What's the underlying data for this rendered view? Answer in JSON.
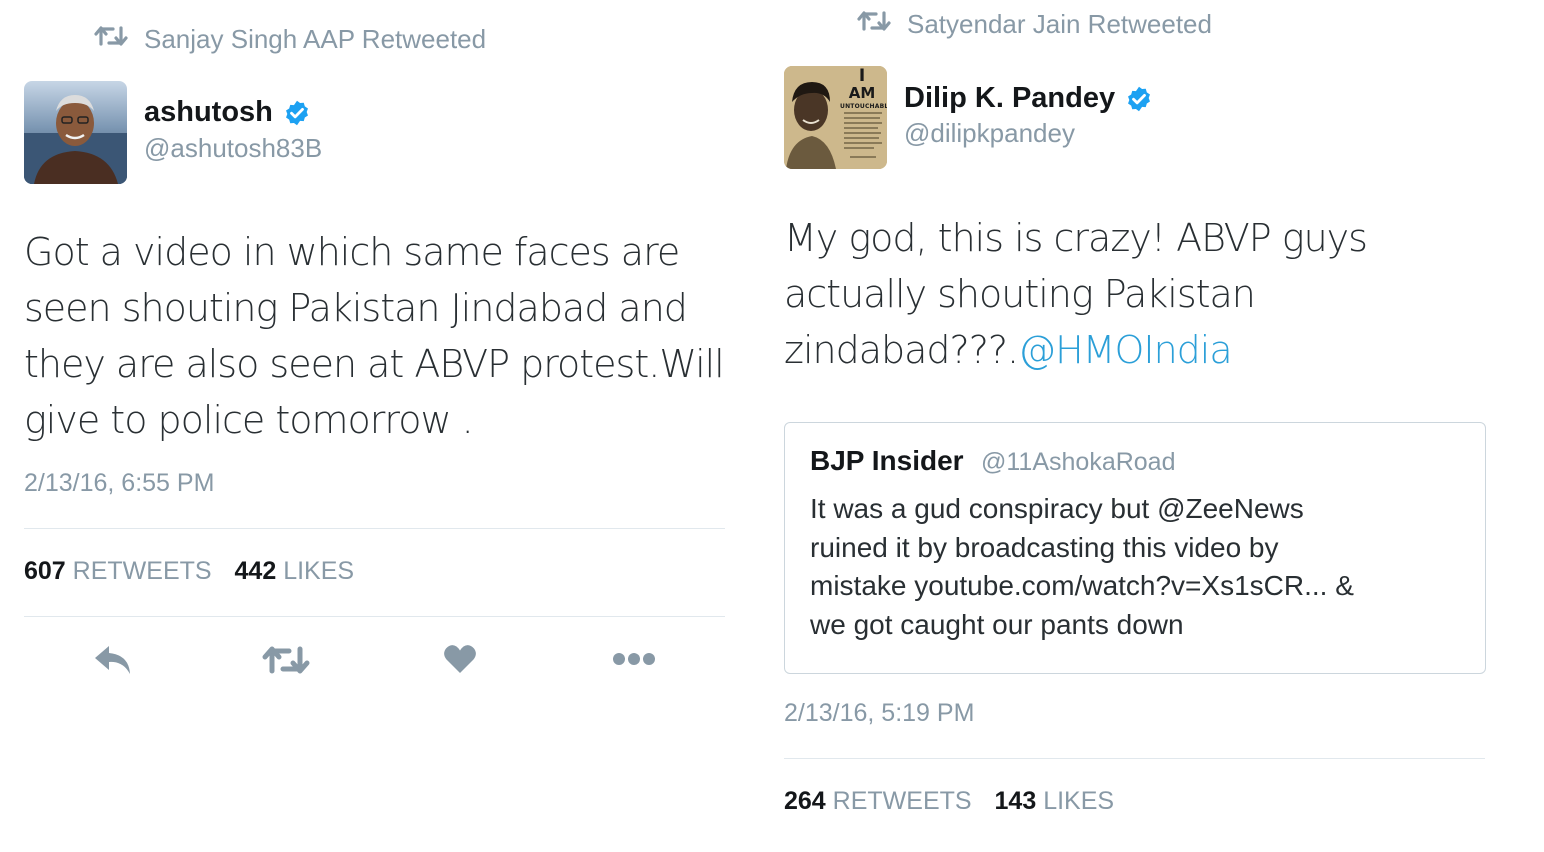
{
  "left_tweet": {
    "retweeted_by": "Sanjay Singh AAP Retweeted",
    "author_name": "ashutosh",
    "author_handle": "@ashutosh83B",
    "text_lines": [
      "Got a video in which same faces are",
      "seen shouting Pakistan Jindabad and",
      "they are also seen at ABVP protest.Will",
      "give to police tomorrow ."
    ],
    "timestamp": "2/13/16, 6:55 PM",
    "retweets_count": "607",
    "retweets_label": "RETWEETS",
    "likes_count": "442",
    "likes_label": "LIKES",
    "actions": [
      "reply-icon",
      "retweet-icon",
      "like-icon",
      "more-icon"
    ]
  },
  "right_tweet": {
    "retweeted_by": "Satyendar Jain Retweeted",
    "author_name": "Dilip K. Pandey",
    "author_handle": "@dilipkpandey",
    "avatar_text": {
      "line1": "I",
      "line2": "AM",
      "line3": "UNTOUCHABLE"
    },
    "text_line1": "My god, this is crazy! ABVP guys",
    "text_line2": "actually shouting Pakistan",
    "text_line3_plain": "zindabad???.",
    "text_line3_mention": "@HMOIndia",
    "quoted_tweet": {
      "author_name": "BJP Insider",
      "author_handle": "@11AshokaRoad",
      "text_lines": [
        "It was a gud conspiracy but @ZeeNews",
        "ruined it by broadcasting this video by",
        "mistake youtube.com/watch?v=Xs1sCR... &",
        "we got caught our pants down"
      ]
    },
    "timestamp": "2/13/16, 5:19 PM",
    "retweets_count": "264",
    "retweets_label": "RETWEETS",
    "likes_count": "143",
    "likes_label": "LIKES"
  },
  "colors": {
    "muted": "#8899a6",
    "text": "#292f33",
    "link": "#2b9fd8",
    "verified": "#1da1f2",
    "divider": "#e1e8ed"
  }
}
